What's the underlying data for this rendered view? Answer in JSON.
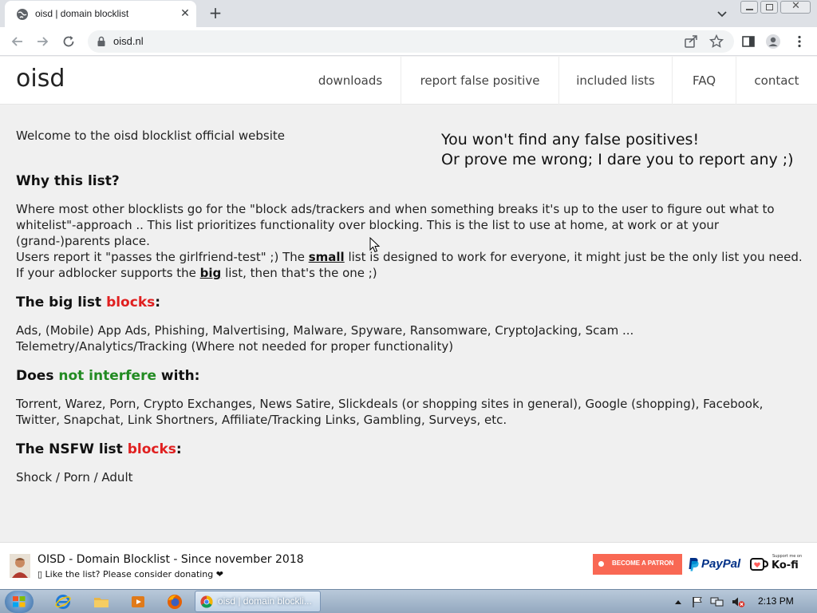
{
  "browser": {
    "tab_title": "oisd | domain blocklist",
    "url": "oisd.nl"
  },
  "site": {
    "logo": "oisd",
    "nav": [
      "downloads",
      "report false positive",
      "included lists",
      "FAQ",
      "contact"
    ]
  },
  "content": {
    "welcome": "Welcome to the oisd blocklist official website",
    "tagline_1": "You won't find any false positives!",
    "tagline_2": "Or prove me wrong; I dare you to report any ;)",
    "why_heading": "Why this list?",
    "why_p1_l1": "Where most other blocklists go for the \"block ads/trackers and when something breaks it's up to the user to figure out what to",
    "why_p1_l2": "whitelist\"-approach .. This list prioritizes functionality over blocking. This is the list to use at home, at work or at your",
    "why_p1_l3": "(grand-)parents place.",
    "why_p2_a": "Users report it \"passes the girlfriend-test\" ;) The ",
    "why_p2_link": "small",
    "why_p2_b": " list is designed to work for everyone, it might just be the only list you need.",
    "why_p3_a": "If your adblocker supports the ",
    "why_p3_link": "big",
    "why_p3_b": " list, then that's the one ;)",
    "big_heading_a": "The big list ",
    "big_heading_b": "blocks",
    "big_heading_c": ":",
    "big_l1": "Ads, (Mobile) App Ads, Phishing, Malvertising, Malware, Spyware, Ransomware, CryptoJacking, Scam ...",
    "big_l2": "Telemetry/Analytics/Tracking (Where not needed for proper functionality)",
    "interfere_a": "Does ",
    "interfere_b": "not interfere",
    "interfere_c": " with:",
    "interfere_l1": "Torrent, Warez, Porn, Crypto Exchanges, News Satire, Slickdeals (or shopping sites in general), Google (shopping), Facebook,",
    "interfere_l2": "Twitter, Snapchat, Link Shortners, Affiliate/Tracking Links, Gambling, Surveys, etc.",
    "nsfw_a": "The NSFW list ",
    "nsfw_b": "blocks",
    "nsfw_c": ":",
    "nsfw_l1": "Shock / Porn / Adult"
  },
  "footer": {
    "title": "OISD - Domain Blocklist - Since november 2018",
    "subtitle": "▯ Like the list? Please consider donating ❤",
    "patreon": "BECOME A PATRON",
    "paypal": "PayPal",
    "kofi_small": "Support me on",
    "kofi": "Ko-fi"
  },
  "taskbar": {
    "chrome_label": "oisd | domain blockli...",
    "clock": "2:13 PM"
  },
  "colors": {
    "red": "#e02020",
    "green": "#228b22",
    "patreon": "#f96854",
    "paypal_dark": "#003087",
    "paypal_light": "#009cde"
  }
}
